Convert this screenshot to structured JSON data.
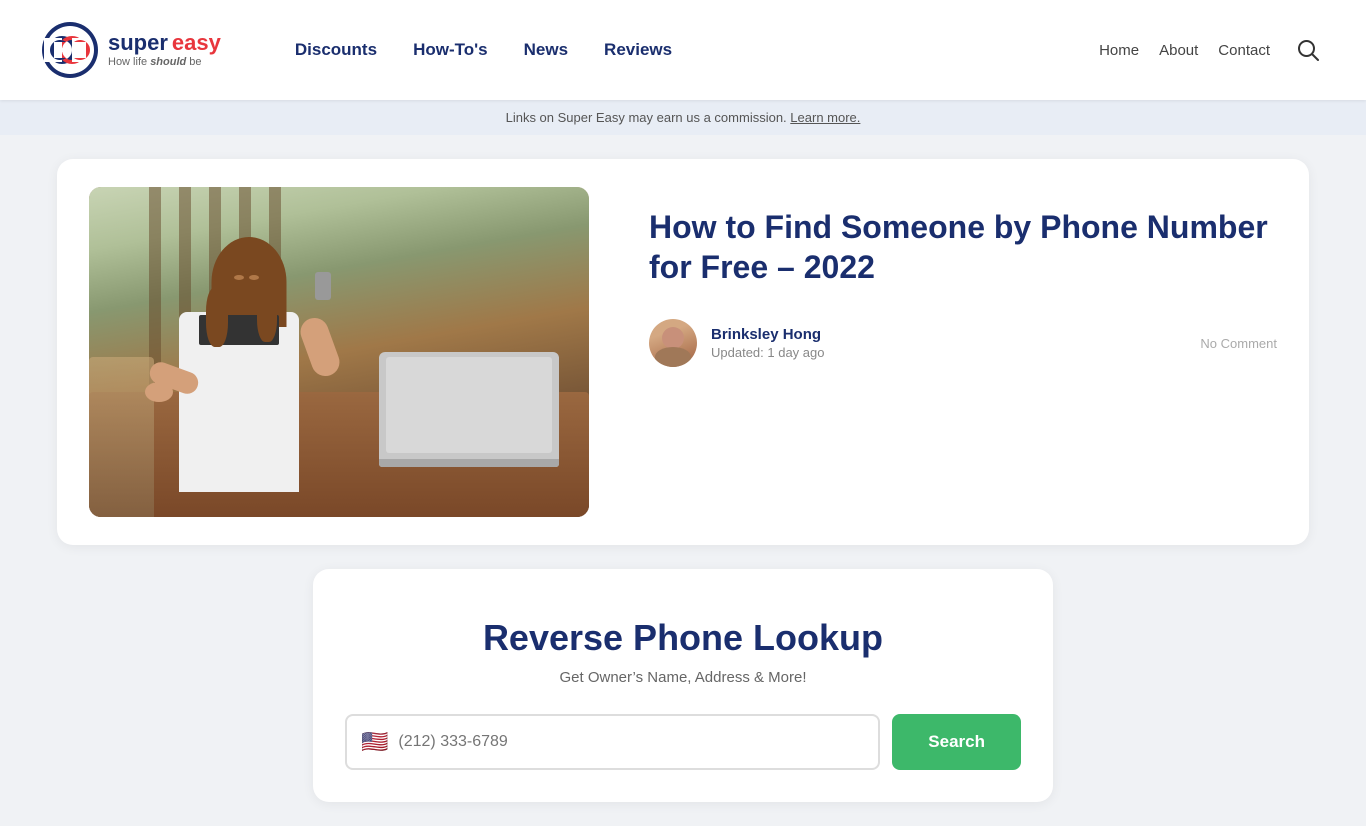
{
  "header": {
    "logo": {
      "super": "super",
      "easy": "easy",
      "tagline_pre": "How life ",
      "tagline_em": "should",
      "tagline_post": " be"
    },
    "nav": {
      "items": [
        {
          "label": "Discounts",
          "href": "#"
        },
        {
          "label": "How-To's",
          "href": "#"
        },
        {
          "label": "News",
          "href": "#"
        },
        {
          "label": "Reviews",
          "href": "#"
        }
      ]
    },
    "right_nav": {
      "items": [
        {
          "label": "Home",
          "href": "#"
        },
        {
          "label": "About",
          "href": "#"
        },
        {
          "label": "Contact",
          "href": "#"
        }
      ]
    }
  },
  "disclaimer": {
    "text": "Links on Super Easy may earn us a commission.",
    "link_text": "Learn more."
  },
  "article": {
    "title": "How to Find Someone by Phone Number for Free – 2022",
    "author_name": "Brinksley Hong",
    "author_date": "Updated: 1 day ago",
    "comment_count": "No Comment"
  },
  "widget": {
    "title": "Reverse Phone Lookup",
    "subtitle": "Get Owner’s Name, Address & More!",
    "input_placeholder": "(212) 333-6789",
    "search_label": "Search"
  }
}
